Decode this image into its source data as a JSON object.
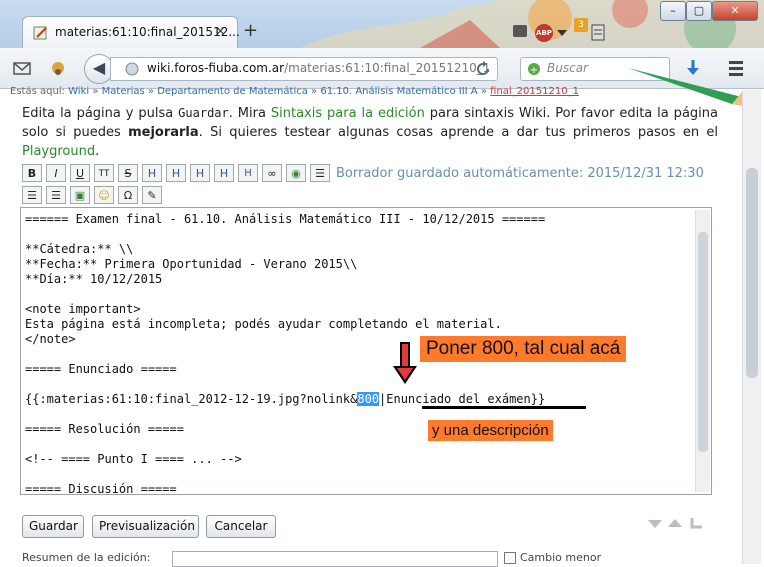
{
  "browser": {
    "tab_title": "materias:61:10:final_201512...",
    "tab_close": "×",
    "new_tab": "+",
    "abp": "ABP",
    "badge_count": "3",
    "url_domain": "wiki.foros-fiuba.com.ar",
    "url_path": "/materias:61:10:final_20151210_1",
    "search_placeholder": "Buscar"
  },
  "breadcrumb": {
    "prefix": "Estás aquí:",
    "items": [
      "Wiki",
      "Materias",
      "Departamento de Matemática",
      "61.10. Análisis Matemático III A"
    ],
    "current": "final_20151210_1",
    "sep": "»"
  },
  "intro": {
    "t1": "Edita la página y pulsa ",
    "save_word": "Guardar",
    "t2": ". Mira ",
    "syntax_link": "Sintaxis para la edición",
    "t3": " para sintaxis Wiki. Por favor edita la página solo si puedes ",
    "improve": "mejorarla",
    "t4": ". Si quieres testear algunas cosas aprende a dar tus primeros pasos en el ",
    "playground_link": "Playground",
    "t5": "."
  },
  "toolbar": {
    "row1": [
      "B",
      "I",
      "U",
      "TT",
      "S",
      "H",
      "H",
      "H",
      "H",
      "H",
      "∞",
      "◉",
      "☰"
    ],
    "row2": [
      "☰",
      "☰",
      "▣",
      "☺",
      "Ω",
      "✎"
    ]
  },
  "autosave": "Borrador guardado automáticamente: 2015/12/31 12:30",
  "editor": {
    "before_highlight": "====== Examen final - 61.10. Análisis Matemático III - 10/12/2015 ======\n\n**Cátedra:** \\\\\n**Fecha:** Primera Oportunidad - Verano 2015\\\\\n**Día:** 10/12/2015\n\n<note important>\nEsta página está incompleta; podés ayudar completando el material.\n</note>\n\n===== Enunciado =====\n\n{{:materias:61:10:final_2012-12-19.jpg?nolink&",
    "highlight": "800",
    "after_highlight": "|Enunciado del exámen}}\n\n===== Resolución =====\n\n<!-- ==== Punto I ==== ... -->\n\n===== Discusión ====="
  },
  "buttons": {
    "save": "Guardar",
    "preview": "Previsualización",
    "cancel": "Cancelar"
  },
  "summary_label": "Resumen de la edición:",
  "minor_label": "Cambio menor",
  "annotations": {
    "put800": "Poner 800, tal cual acá",
    "description": "y una descripción"
  },
  "colors": {
    "annotation_bg": "#ff7a2b",
    "link_green": "#2a8a2a",
    "highlight": "#3399ff"
  }
}
